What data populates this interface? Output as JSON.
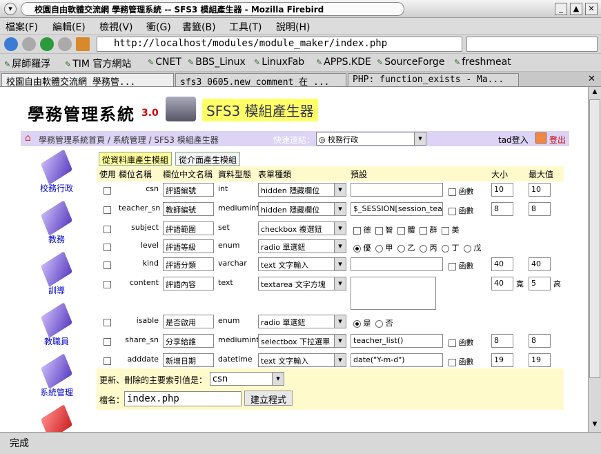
{
  "window": {
    "title": "校園自由軟體交流網 學務管理系統 -- SFS3 模組產生器 - Mozilla Firebird"
  },
  "menu": [
    "檔案(F)",
    "編輯(E)",
    "檢視(V)",
    "衝(G)",
    "書籤(B)",
    "工具(T)",
    "說明(H)"
  ],
  "nav": {
    "url": "http://localhost/modules/module_maker/index.php"
  },
  "bookmarks": [
    "屏師羅浮",
    "TIM 官方網站",
    "CNET",
    "BBS_Linux",
    "LinuxFab",
    "APPS.KDE",
    "SourceForge",
    "freshmeat"
  ],
  "tabs": [
    "校園自由軟體交流網 學務管...",
    "sfs3_0605.new_comment 在 ...",
    "PHP: function_exists - Ma..."
  ],
  "header": {
    "logo": "學務管理系統",
    "version": "3.0",
    "app_title": "SFS3 模組產生器"
  },
  "breadcrumb": {
    "text": "學務管理系統首頁 / 系統管理 / SFS3 模組產生器",
    "quick_label": "快速連結：",
    "quick_value": "◎ 校務行政",
    "user": "tad登入",
    "logout": "登出"
  },
  "sidebar": [
    "校務行政",
    "教務",
    "訓導",
    "教職員",
    "系統管理"
  ],
  "subtabs": [
    "從資料庫產生模組",
    "從介面產生模組"
  ],
  "columns": [
    "使用",
    "欄位名稱",
    "欄位中文名稱",
    "資料型態",
    "表單種類",
    "預設",
    "大小",
    "最大值"
  ],
  "rows": [
    {
      "name": "csn",
      "cname": "評語編號",
      "type": "int",
      "form": "hidden 隱藏欄位",
      "default": "",
      "fn": "函數",
      "size": "10",
      "max": "10"
    },
    {
      "name": "teacher_sn",
      "cname": "教師編號",
      "type": "mediumint",
      "form": "hidden 隱藏欄位",
      "default": "$_SESSION[session_tea",
      "fn": "函數",
      "size": "8",
      "max": "8"
    },
    {
      "name": "subject",
      "cname": "評語範圍",
      "type": "set",
      "form": "checkbox 複選鈕",
      "opts": [
        "德",
        "智",
        "體",
        "群",
        "美"
      ]
    },
    {
      "name": "level",
      "cname": "評語等級",
      "type": "enum",
      "form": "radio 單選鈕",
      "opts": [
        "優",
        "甲",
        "乙",
        "丙",
        "丁",
        "戊"
      ]
    },
    {
      "name": "kind",
      "cname": "評語分類",
      "type": "varchar",
      "form": "text 文字輸入",
      "default": "",
      "fn": "函數",
      "size": "40",
      "max": "40"
    },
    {
      "name": "content",
      "cname": "評語內容",
      "type": "text",
      "form": "textarea 文字方塊",
      "size": "40",
      "wlabel": "寬",
      "max": "5",
      "hlabel": "高"
    },
    {
      "name": "isable",
      "cname": "是否啟用",
      "type": "enum",
      "form": "radio 單選鈕",
      "opts": [
        "是",
        "否"
      ]
    },
    {
      "name": "share_sn",
      "cname": "分享給誰",
      "type": "mediumint",
      "form": "selectbox 下拉選單",
      "default": "teacher_list()",
      "fn": "函數",
      "size": "8",
      "max": "8"
    },
    {
      "name": "adddate",
      "cname": "新增日期",
      "type": "datetime",
      "form": "text 文字輸入",
      "default": "date(\"Y-m-d\")",
      "fn": "函數",
      "size": "19",
      "max": "19"
    }
  ],
  "bottom": {
    "index_label": "更新、刪除的主要索引值是：",
    "index_value": "csn",
    "file_label": "檔名：",
    "file_value": "index.php",
    "submit": "建立程式"
  },
  "status": "完成"
}
